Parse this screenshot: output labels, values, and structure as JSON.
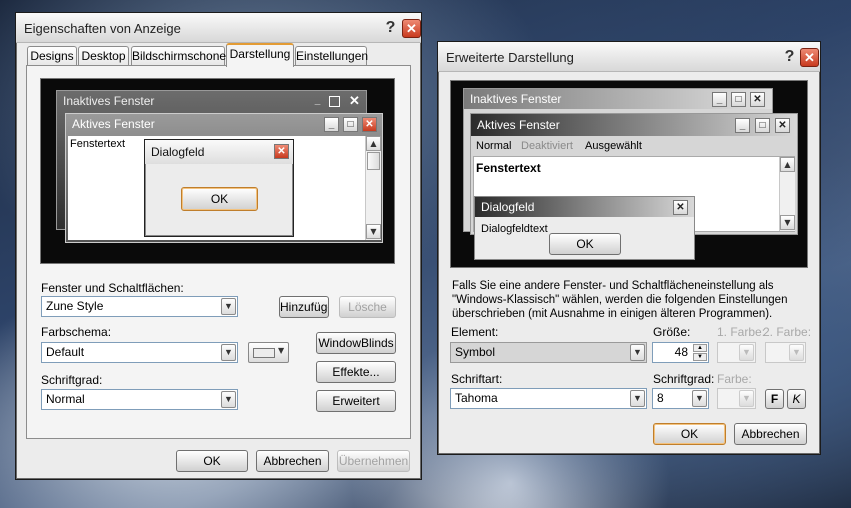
{
  "left_window": {
    "title": "Eigenschaften von Anzeige",
    "help_glyph": "?",
    "close_glyph": "✕",
    "tabs": [
      "Designs",
      "Desktop",
      "Bildschirmschoner",
      "Darstellung",
      "Einstellungen"
    ],
    "active_tab": "Darstellung",
    "preview": {
      "inactive_title": "Inaktives Fenster",
      "active_title": "Aktives Fenster",
      "window_text": "Fenstertext",
      "dialog_title": "Dialogfeld",
      "dialog_ok": "OK"
    },
    "windows_buttons_label": "Fenster und Schaltflächen:",
    "windows_buttons_value": "Zune Style",
    "add_button": "Hinzufügen",
    "delete_button": "Lösche",
    "color_scheme_label": "Farbschema:",
    "color_scheme_value": "Default",
    "windowblinds_button": "WindowBlinds",
    "effects_button": "Effekte...",
    "font_size_label": "Schriftgrad:",
    "font_size_value": "Normal",
    "advanced_button": "Erweitert",
    "ok_button": "OK",
    "cancel_button": "Abbrechen",
    "apply_button": "Übernehmen"
  },
  "right_window": {
    "title": "Erweiterte Darstellung",
    "help_glyph": "?",
    "close_glyph": "✕",
    "preview": {
      "inactive_title": "Inaktives Fenster",
      "active_title": "Aktives Fenster",
      "menu": [
        "Normal",
        "Deaktiviert",
        "Ausgewählt"
      ],
      "window_text": "Fenstertext",
      "dialog_title": "Dialogfeld",
      "dialog_text": "Dialogfeldtext",
      "dialog_ok": "OK"
    },
    "info_text": "Falls Sie eine andere Fenster- und Schaltflächeneinstellung als \"Windows-Klassisch\" wählen, werden die folgenden Einstellungen überschrieben (mit Ausnahme in einigen älteren Programmen).",
    "element_label": "Element:",
    "element_value": "Symbol",
    "size_label": "Größe:",
    "size_value": "48",
    "color1_label": "1. Farbe:",
    "color2_label": "2. Farbe:",
    "font_label": "Schriftart:",
    "font_value": "Tahoma",
    "font_size_label": "Schriftgrad:",
    "font_size_value": "8",
    "font_color_label": "Farbe:",
    "bold_button": "F",
    "italic_button": "K",
    "ok_button": "OK",
    "cancel_button": "Abbrechen"
  },
  "colors": {
    "accent_orange": "#e39b34",
    "close_red": "#c83a1f",
    "preview_black": "#0a0a0a"
  }
}
